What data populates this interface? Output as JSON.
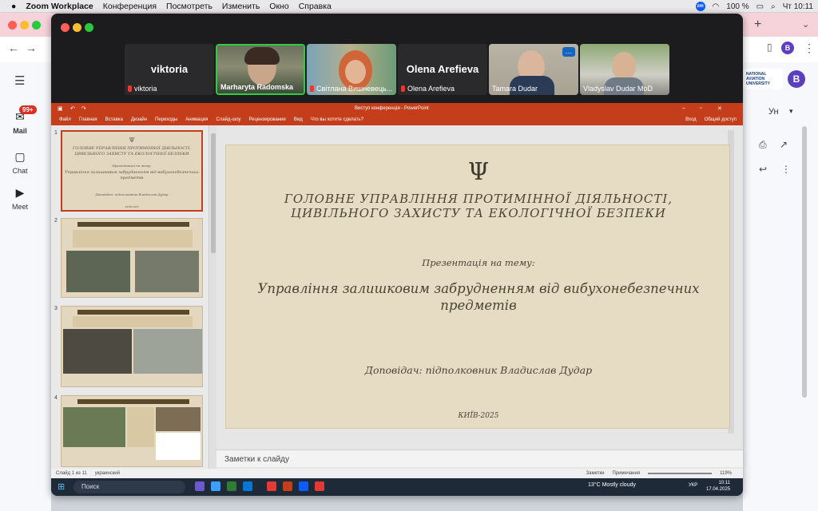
{
  "menubar": {
    "app": "Zoom Workplace",
    "items": [
      "Конференция",
      "Посмотреть",
      "Изменить",
      "Окно",
      "Справка"
    ],
    "battery": "100 %",
    "clock": "Чт 10:11"
  },
  "participants": [
    {
      "name": "viktoria",
      "label": "viktoria",
      "video": false
    },
    {
      "name": "Marharyta Radomska",
      "label": "Marharyta Radomska",
      "video": true,
      "active": true
    },
    {
      "name": "Світлана Вишневець...",
      "label": "Світлана Вишневець...",
      "video": true
    },
    {
      "name": "Olena Arefieva",
      "label": "Olena Arefieva",
      "video": false
    },
    {
      "name": "Tamara Dudar",
      "label": "Tamara Dudar",
      "video": true
    },
    {
      "name": "Vladyslav Dudar MoD",
      "label": "Vladyslav Dudar MoD",
      "video": true
    }
  ],
  "ppt": {
    "title": "Виступ конференція - PowerPoint",
    "ribbon": [
      "Файл",
      "Главная",
      "Вставка",
      "Дизайн",
      "Переходы",
      "Анимация",
      "Слайд-шоу",
      "Рецензирование",
      "Вид",
      "Что вы хотите сделать?"
    ],
    "signin": "Вход",
    "share": "Общий доступ",
    "thumb_numbers": [
      "1",
      "2",
      "3",
      "4"
    ],
    "notes_placeholder": "Заметки к слайду",
    "status_left": "Слайд 1 из 11",
    "status_lang": "украинский",
    "status_notes": "Заметки",
    "status_comments": "Примечания",
    "zoom": "119%"
  },
  "slide": {
    "org_line1": "ГОЛОВНЕ УПРАВЛІННЯ ПРОТИМІННОЇ ДІЯЛЬНОСТІ,",
    "org_line2": "ЦИВІЛЬНОГО ЗАХИСТУ ТА ЕКОЛОГІЧНОЇ БЕЗПЕКИ",
    "presentation_on": "Презентація на тему:",
    "topic_line1": "Управління залишковим забрудненням від вибухонебезпечних",
    "topic_line2": "предметів",
    "speaker": "Доповідач: підполковник Владислав Дудар",
    "city_year": "КИЇВ-2025"
  },
  "taskbar": {
    "search": "Поиск",
    "weather": "13°C  Mostly cloudy",
    "lang": "УКР",
    "time": "10:11",
    "date": "17.04.2025"
  },
  "gmail": {
    "mail": "Mail",
    "chat": "Chat",
    "meet": "Meet",
    "badge": "99+",
    "avatar": "B",
    "uni": "NATIONAL AVIATION UNIVERSITY",
    "sort": "Ун"
  }
}
